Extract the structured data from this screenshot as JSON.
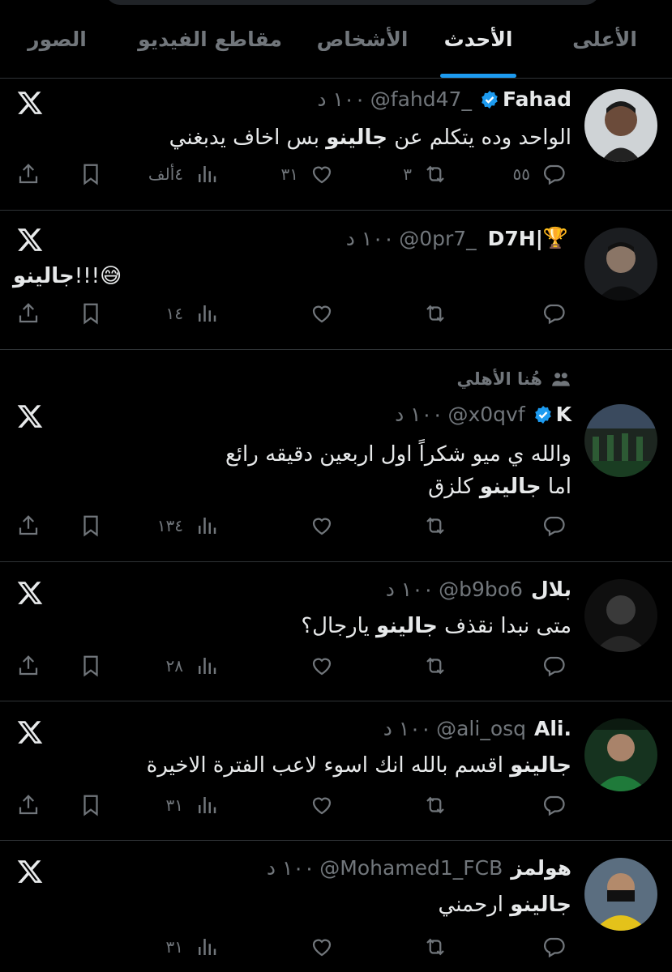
{
  "tabs": [
    {
      "label": "الأعلى",
      "active": false
    },
    {
      "label": "الأحدث",
      "active": true
    },
    {
      "label": "الأشخاص",
      "active": false
    },
    {
      "label": "مقاطع الفيديو",
      "active": false
    },
    {
      "label": "الصور",
      "active": false
    }
  ],
  "colors": {
    "background": "#000000",
    "accent": "#1d9bf0",
    "muted": "#71767b",
    "divider": "#2f3336"
  },
  "tweets": [
    {
      "display_name": "Fahad",
      "verified": true,
      "handle": "@fahd47_",
      "time": "١٠٠ د",
      "body_pre": "الواحد وده يتكلم عن ",
      "body_bold": "جالينو",
      "body_post": " بس اخاف يدبغني",
      "replies": "٥٥",
      "retweets": "٣",
      "likes": "٣١",
      "views": "٤ألف"
    },
    {
      "display_name": "D7H|",
      "trophy": "🏆",
      "verified": false,
      "handle": "@0pr7_",
      "time": "١٠٠ د",
      "body_pre": "!!!😅",
      "body_bold": "جالينو",
      "body_post": "",
      "replies": "",
      "retweets": "",
      "likes": "",
      "views": "١٤"
    },
    {
      "social_context": "هُنا الأهلي",
      "display_name": "K",
      "verified": true,
      "handle": "@x0qvf",
      "time": "١٠٠ د",
      "body_line1": "والله ي ميو شكراً اول اربعين دقيقه رائع",
      "body_pre": "اما ",
      "body_bold": "جالينو",
      "body_post": " كلزق",
      "replies": "",
      "retweets": "",
      "likes": "",
      "views": "١٣٤"
    },
    {
      "display_name": "بلال",
      "verified": false,
      "handle": "@b9bo6",
      "time": "١٠٠ د",
      "body_pre": "متى نبدا نقذف ",
      "body_bold": "جالينو",
      "body_post": " يارجال؟",
      "replies": "",
      "retweets": "",
      "likes": "",
      "views": "٢٨"
    },
    {
      "display_name": "Ali.",
      "verified": false,
      "handle": "@ali_osq",
      "time": "١٠٠ د",
      "body_pre": "",
      "body_bold": "جالينو",
      "body_post": " اقسم بالله انك اسوء لاعب الفترة الاخيرة",
      "replies": "",
      "retweets": "",
      "likes": "",
      "views": "٣١"
    },
    {
      "display_name": "هولمز",
      "verified": false,
      "handle": "@Mohamed1_FCB",
      "time": "١٠٠ د",
      "body_pre": "",
      "body_bold": "جالينو",
      "body_post": " ارحمني",
      "replies": "",
      "retweets": "",
      "likes": "",
      "views": "٣١"
    }
  ]
}
